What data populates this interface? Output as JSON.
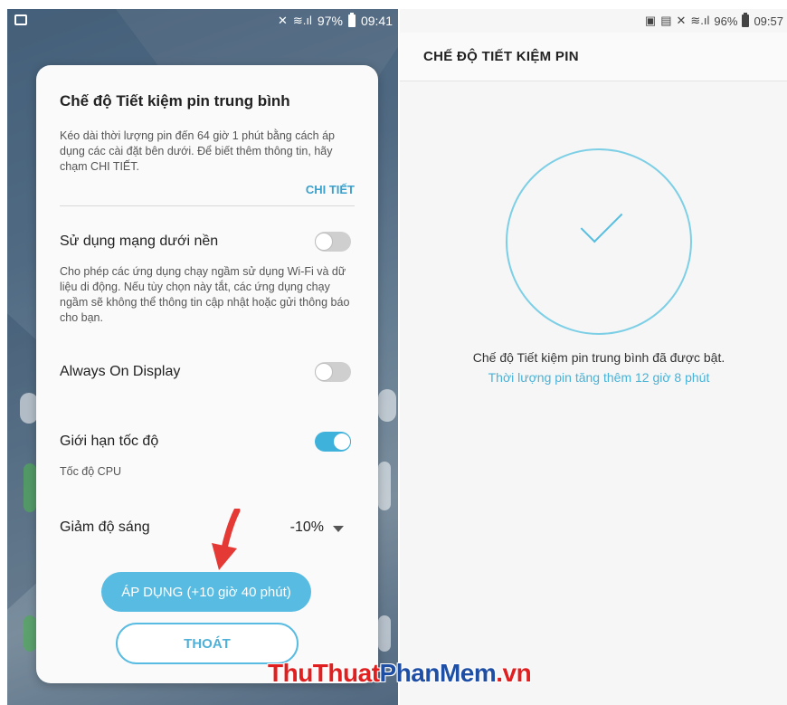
{
  "left_status": {
    "battery": "97%",
    "time": "09:41"
  },
  "dialog": {
    "title": "Chế độ Tiết kiệm pin trung bình",
    "description": "Kéo dài thời lượng pin đến 64 giờ 1 phút bằng cách áp dụng các cài đặt bên dưới. Để biết thêm thông tin, hãy chạm CHI TIẾT.",
    "details_link": "CHI TIẾT",
    "settings": [
      {
        "label": "Sử dụng mạng dưới nền",
        "description": "Cho phép các ứng dụng chạy ngầm sử dụng Wi-Fi và dữ liệu di động. Nếu tùy chọn này tắt, các ứng dụng chạy ngầm sẽ không thể thông tin cập nhật hoặc gửi thông báo cho bạn.",
        "enabled": false
      },
      {
        "label": "Always On Display",
        "enabled": false
      },
      {
        "label": "Giới hạn tốc độ",
        "description": "Tốc độ CPU",
        "enabled": true
      },
      {
        "label": "Giảm độ sáng",
        "value": "-10%"
      }
    ],
    "apply_button": "ÁP DỤNG (+10 giờ 40 phút)",
    "exit_button": "THOÁT"
  },
  "right_status": {
    "battery": "96%",
    "time": "09:57"
  },
  "right_screen": {
    "title": "CHẾ ĐỘ TIẾT KIỆM PIN",
    "message": "Chế độ Tiết kiệm pin trung bình đã được bật.",
    "extra": "Thời lượng pin tăng thêm 12 giờ 8 phút"
  },
  "watermark": {
    "part1": "ThuThuat",
    "part2": "PhanMem",
    "part3": ".vn"
  },
  "colors": {
    "accent": "#58bbe2",
    "arrow": "#e53935"
  }
}
